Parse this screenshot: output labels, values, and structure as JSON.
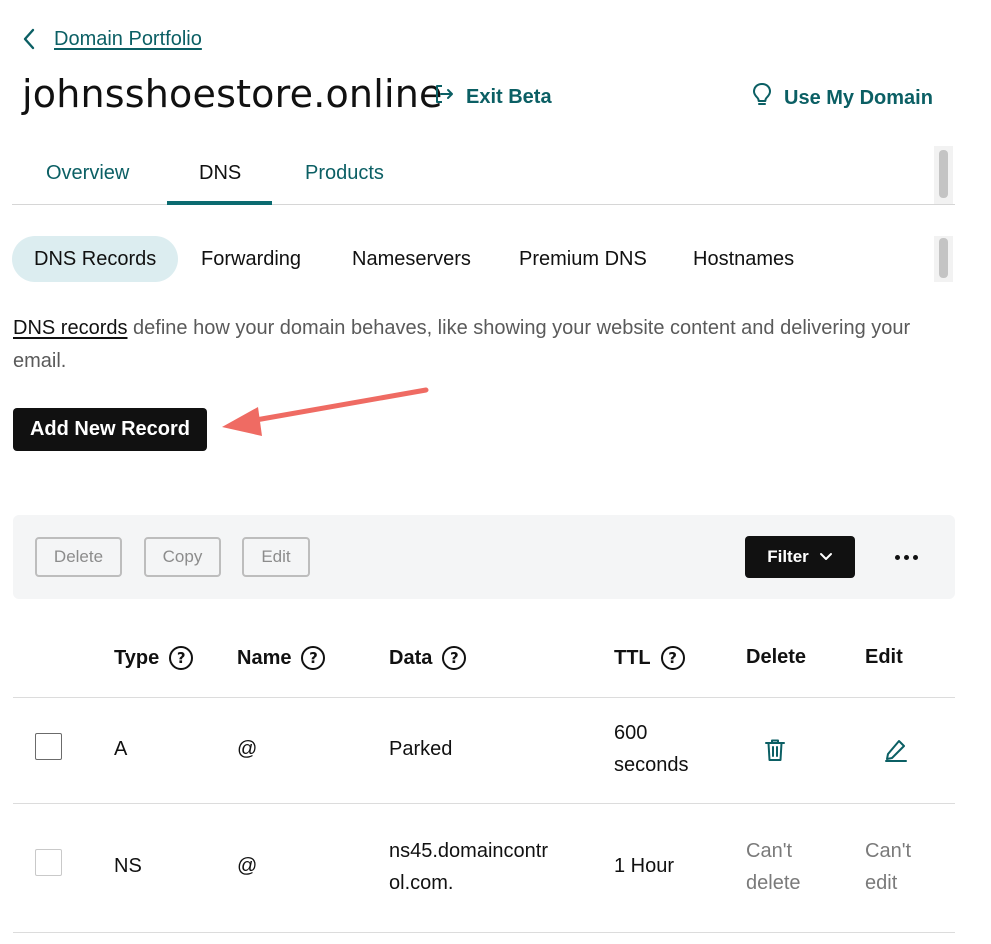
{
  "breadcrumb": {
    "label": "Domain Portfolio"
  },
  "header": {
    "domain": "johnsshoestore.online",
    "exit_beta": "Exit Beta",
    "use_my_domain": "Use My Domain"
  },
  "tabs": [
    {
      "label": "Overview"
    },
    {
      "label": "DNS"
    },
    {
      "label": "Products"
    }
  ],
  "active_tab": "DNS",
  "subtabs": [
    {
      "label": "DNS Records"
    },
    {
      "label": "Forwarding"
    },
    {
      "label": "Nameservers"
    },
    {
      "label": "Premium DNS"
    },
    {
      "label": "Hostnames"
    }
  ],
  "description": {
    "link": "DNS records",
    "text": " define how your domain behaves, like showing your website content and delivering your email."
  },
  "add_button": "Add New Record",
  "toolbar": {
    "delete": "Delete",
    "copy": "Copy",
    "edit": "Edit",
    "filter": "Filter"
  },
  "table": {
    "headers": {
      "type": "Type",
      "name": "Name",
      "data": "Data",
      "ttl": "TTL",
      "delete": "Delete",
      "edit": "Edit"
    },
    "rows": [
      {
        "type": "A",
        "name": "@",
        "data": "Parked",
        "ttl_line1": "600",
        "ttl_line2": "seconds",
        "delete_icon": "trash-icon",
        "edit_icon": "pencil-icon"
      },
      {
        "type": "NS",
        "name": "@",
        "data_line1": "ns45.domaincontr",
        "data_line2": "ol.com.",
        "ttl": "1 Hour",
        "delete_line1": "Can't",
        "delete_line2": "delete",
        "edit_line1": "Can't",
        "edit_line2": "edit"
      }
    ]
  },
  "colors": {
    "teal": "#0b5f64",
    "accent_bg": "#dcedf0",
    "arrow": "#ef6b63",
    "button": "#111111"
  }
}
